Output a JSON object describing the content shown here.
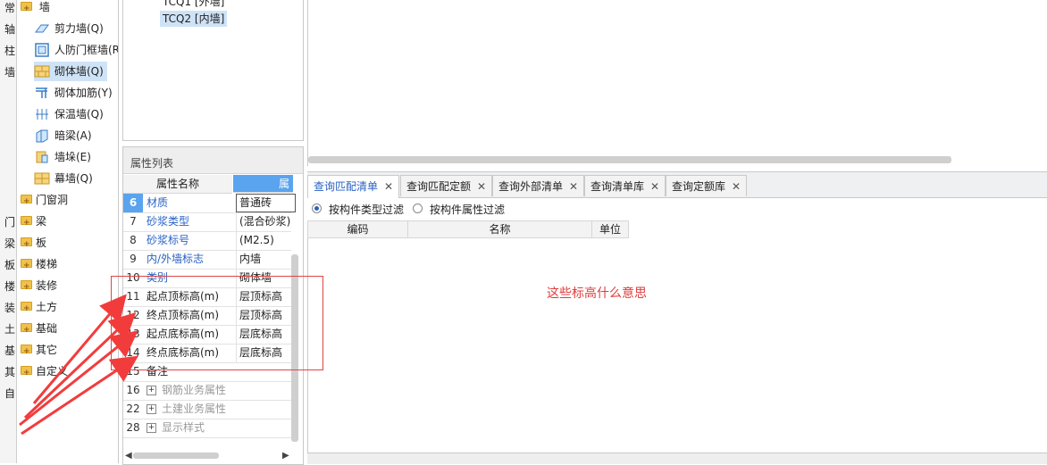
{
  "left_strip": [
    "常",
    "轴",
    "柱",
    "墙",
    "",
    "",
    "",
    "",
    "",
    "",
    "门",
    "梁",
    "板",
    "楼",
    "装",
    "土",
    "基",
    "其",
    "自"
  ],
  "tree": {
    "root_label": "墙",
    "children": [
      {
        "label": "剪力墙(Q)",
        "icon": "shear-wall-icon"
      },
      {
        "label": "人防门框墙(R",
        "icon": "door-frame-wall-icon"
      },
      {
        "label": "砌体墙(Q)",
        "icon": "masonry-wall-icon",
        "selected": true
      },
      {
        "label": "砌体加筋(Y)",
        "icon": "masonry-rebar-icon"
      },
      {
        "label": "保温墙(Q)",
        "icon": "insulation-wall-icon"
      },
      {
        "label": "暗梁(A)",
        "icon": "hidden-beam-icon"
      },
      {
        "label": "墙垛(E)",
        "icon": "wall-pier-icon"
      },
      {
        "label": "幕墙(Q)",
        "icon": "curtain-wall-icon"
      }
    ],
    "folders": [
      "门窗洞",
      "梁",
      "板",
      "楼梯",
      "装修",
      "土方",
      "基础",
      "其它",
      "自定义"
    ]
  },
  "top_list": {
    "items": [
      "TCQ1 [外墙]",
      "TCQ2 [内墙]"
    ],
    "selected_index": 1
  },
  "property_panel": {
    "title": "属性列表",
    "col_name": "属性名称",
    "col_value": "属",
    "rows": [
      {
        "num": "6",
        "name": "材质",
        "value": "普通砖",
        "blue": true
      },
      {
        "num": "7",
        "name": "砂浆类型",
        "value": "(混合砂浆)",
        "blue": true
      },
      {
        "num": "8",
        "name": "砂浆标号",
        "value": "(M2.5)",
        "blue": true
      },
      {
        "num": "9",
        "name": "内/外墙标志",
        "value": "内墙",
        "blue": true
      },
      {
        "num": "10",
        "name": "类别",
        "value": "砌体墙",
        "blue": true
      },
      {
        "num": "11",
        "name": "起点顶标高(m)",
        "value": "层顶标高"
      },
      {
        "num": "12",
        "name": "终点顶标高(m)",
        "value": "层顶标高"
      },
      {
        "num": "13",
        "name": "起点底标高(m)",
        "value": "层底标高"
      },
      {
        "num": "14",
        "name": "终点底标高(m)",
        "value": "层底标高"
      },
      {
        "num": "15",
        "name": "备注",
        "value": ""
      },
      {
        "num": "16",
        "name": "钢筋业务属性",
        "value": "",
        "group": true
      },
      {
        "num": "22",
        "name": "土建业务属性",
        "value": "",
        "group": true
      },
      {
        "num": "28",
        "name": "显示样式",
        "value": "",
        "group": true
      }
    ]
  },
  "tabs": [
    {
      "label": "查询匹配清单",
      "active": true
    },
    {
      "label": "查询匹配定额"
    },
    {
      "label": "查询外部清单"
    },
    {
      "label": "查询清单库"
    },
    {
      "label": "查询定额库"
    }
  ],
  "close_glyph": "✕",
  "filters": {
    "by_type": "按构件类型过滤",
    "by_property": "按构件属性过滤",
    "selected": "by_type"
  },
  "grid_headers": [
    "编码",
    "名称",
    "单位"
  ],
  "annotation_note": "这些标高什么意思",
  "colors": {
    "accent": "#2a62c4",
    "annotation": "#e04545",
    "selection": "#cfe3f7"
  }
}
